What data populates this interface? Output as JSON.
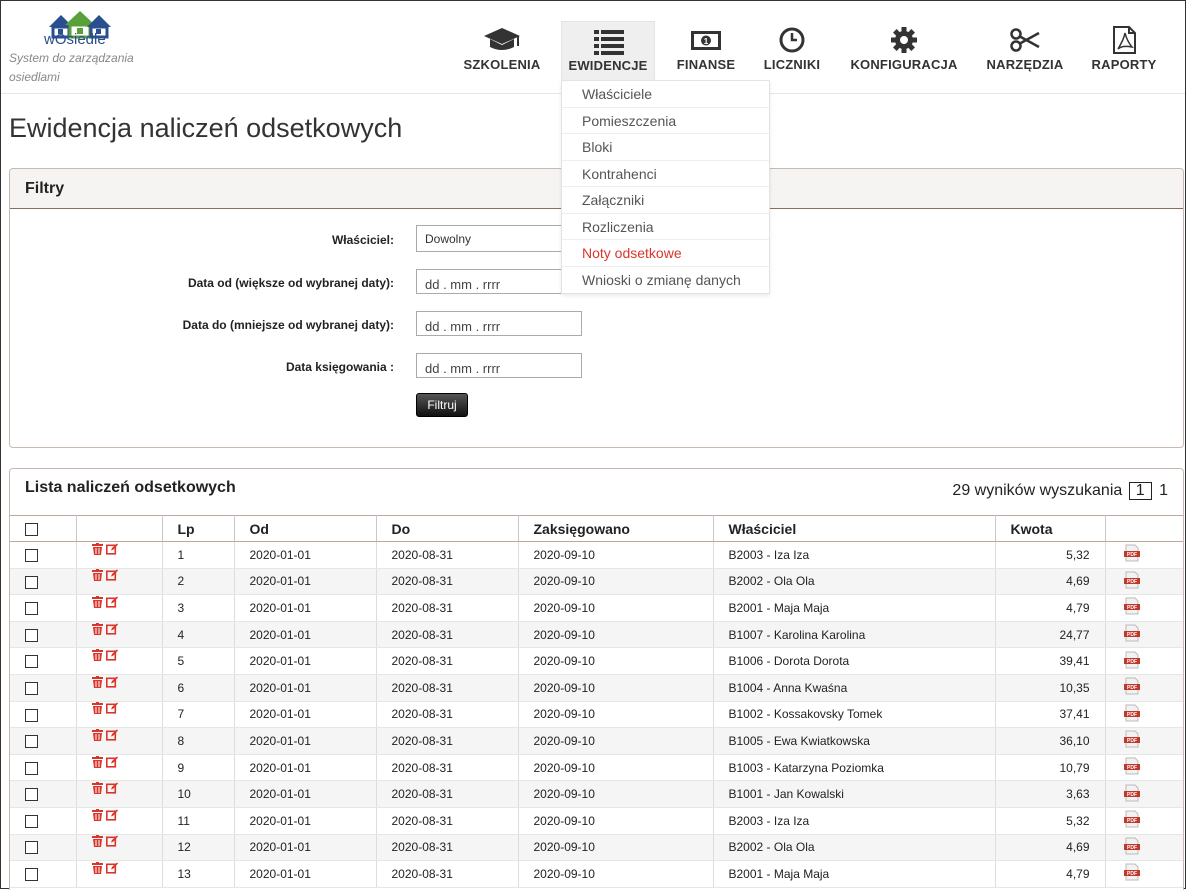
{
  "brand": {
    "logo_text": "wOsiedle",
    "tagline": "System do zarządzania osiedlami"
  },
  "nav": [
    {
      "label": "SZKOLENIA",
      "icon": "graduation-cap-icon"
    },
    {
      "label": "EWIDENCJE",
      "icon": "list-icon",
      "active": true
    },
    {
      "label": "FINANSE",
      "icon": "banknote-icon"
    },
    {
      "label": "LICZNIKI",
      "icon": "clock-icon"
    },
    {
      "label": "KONFIGURACJA",
      "icon": "gear-icon"
    },
    {
      "label": "NARZĘDZIA",
      "icon": "scissors-icon"
    },
    {
      "label": "RAPORTY",
      "icon": "pdf-file-icon"
    }
  ],
  "dropdown": [
    {
      "label": "Właściciele"
    },
    {
      "label": "Pomieszczenia"
    },
    {
      "label": "Bloki"
    },
    {
      "label": "Kontrahenci"
    },
    {
      "label": "Załączniki"
    },
    {
      "label": "Rozliczenia"
    },
    {
      "label": "Noty odsetkowe",
      "active": true
    },
    {
      "label": "Wnioski o zmianę danych"
    }
  ],
  "page_title": "Ewidencja naliczeń odsetkowych",
  "filters": {
    "title": "Filtry",
    "owner_label": "Właściciel:",
    "owner_value": "Dowolny",
    "date_from_label": "Data od (większe od wybranej daty):",
    "date_to_label": "Data do (mniejsze od wybranej daty):",
    "booking_date_label": "Data księgowania :",
    "date_placeholder": "dd . mm . rrrr",
    "button": "Filtruj"
  },
  "list": {
    "title": "Lista naliczeń odsetkowych",
    "results_text": "29 wyników wyszukania",
    "current_page": "1",
    "total_pages": "1",
    "columns": [
      "Lp",
      "Od",
      "Do",
      "Zaksięgowano",
      "Właściciel",
      "Kwota"
    ],
    "rows": [
      {
        "lp": "1",
        "od": "2020-01-01",
        "do": "2020-08-31",
        "zaks": "2020-09-10",
        "owner": "B2003 - Iza Iza",
        "kwota": "5,32"
      },
      {
        "lp": "2",
        "od": "2020-01-01",
        "do": "2020-08-31",
        "zaks": "2020-09-10",
        "owner": "B2002 - Ola Ola",
        "kwota": "4,69"
      },
      {
        "lp": "3",
        "od": "2020-01-01",
        "do": "2020-08-31",
        "zaks": "2020-09-10",
        "owner": "B2001 - Maja Maja",
        "kwota": "4,79"
      },
      {
        "lp": "4",
        "od": "2020-01-01",
        "do": "2020-08-31",
        "zaks": "2020-09-10",
        "owner": "B1007 - Karolina Karolina",
        "kwota": "24,77"
      },
      {
        "lp": "5",
        "od": "2020-01-01",
        "do": "2020-08-31",
        "zaks": "2020-09-10",
        "owner": "B1006 - Dorota Dorota",
        "kwota": "39,41"
      },
      {
        "lp": "6",
        "od": "2020-01-01",
        "do": "2020-08-31",
        "zaks": "2020-09-10",
        "owner": "B1004 - Anna Kwaśna",
        "kwota": "10,35"
      },
      {
        "lp": "7",
        "od": "2020-01-01",
        "do": "2020-08-31",
        "zaks": "2020-09-10",
        "owner": "B1002 - Kossakovsky Tomek",
        "kwota": "37,41"
      },
      {
        "lp": "8",
        "od": "2020-01-01",
        "do": "2020-08-31",
        "zaks": "2020-09-10",
        "owner": "B1005 - Ewa Kwiatkowska",
        "kwota": "36,10"
      },
      {
        "lp": "9",
        "od": "2020-01-01",
        "do": "2020-08-31",
        "zaks": "2020-09-10",
        "owner": "B1003 - Katarzyna Poziomka",
        "kwota": "10,79"
      },
      {
        "lp": "10",
        "od": "2020-01-01",
        "do": "2020-08-31",
        "zaks": "2020-09-10",
        "owner": "B1001 - Jan Kowalski",
        "kwota": "3,63"
      },
      {
        "lp": "11",
        "od": "2020-01-01",
        "do": "2020-08-31",
        "zaks": "2020-09-10",
        "owner": "B2003 - Iza Iza",
        "kwota": "5,32"
      },
      {
        "lp": "12",
        "od": "2020-01-01",
        "do": "2020-08-31",
        "zaks": "2020-09-10",
        "owner": "B2002 - Ola Ola",
        "kwota": "4,69"
      },
      {
        "lp": "13",
        "od": "2020-01-01",
        "do": "2020-08-31",
        "zaks": "2020-09-10",
        "owner": "B2001 - Maja Maja",
        "kwota": "4,79"
      }
    ]
  },
  "colors": {
    "accent_red": "#d9362b",
    "logo_blue": "#2a4f8f",
    "logo_green": "#5aa03a",
    "panel_border": "#8b6d5c"
  }
}
